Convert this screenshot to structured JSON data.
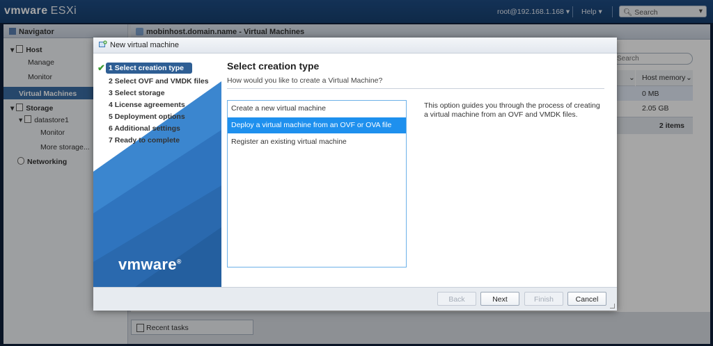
{
  "topbar": {
    "brand_vm": "vmware",
    "brand_esxi": "ESXi",
    "user": "root@192.168.1.168 ▾",
    "help": "Help ▾",
    "search_placeholder": "Search"
  },
  "navigator": {
    "title": "Navigator",
    "items": [
      "Host",
      "Manage",
      "Monitor",
      "Virtual Machines",
      "Storage",
      "datastore1",
      "Monitor",
      "More storage...",
      "Networking"
    ]
  },
  "main": {
    "title": "mobinhost.domain.name - Virtual Machines",
    "search_placeholder": "Search",
    "column_header": "Host memory",
    "rows": [
      "0 MB",
      "2.05 GB"
    ],
    "items_count": "2 items"
  },
  "recent_tasks": "Recent tasks",
  "dialog": {
    "title": "New virtual machine",
    "steps": [
      "1 Select creation type",
      "2 Select OVF and VMDK files",
      "3 Select storage",
      "4 License agreements",
      "5 Deployment options",
      "6 Additional settings",
      "7 Ready to complete"
    ],
    "logo": "vmware",
    "heading": "Select creation type",
    "subheading": "How would you like to create a Virtual Machine?",
    "options": [
      "Create a new virtual machine",
      "Deploy a virtual machine from an OVF or OVA file",
      "Register an existing virtual machine"
    ],
    "selected_option": "Deploy a virtual machine from an OVF or OVA file",
    "description": "This option guides you through the process of creating a virtual machine from an OVF and VMDK files.",
    "buttons": {
      "back": "Back",
      "next": "Next",
      "finish": "Finish",
      "cancel": "Cancel"
    }
  },
  "colors": {
    "accent": "#1e90ee",
    "step_active": "#2e5e94",
    "topbar": "#1f4d85"
  }
}
